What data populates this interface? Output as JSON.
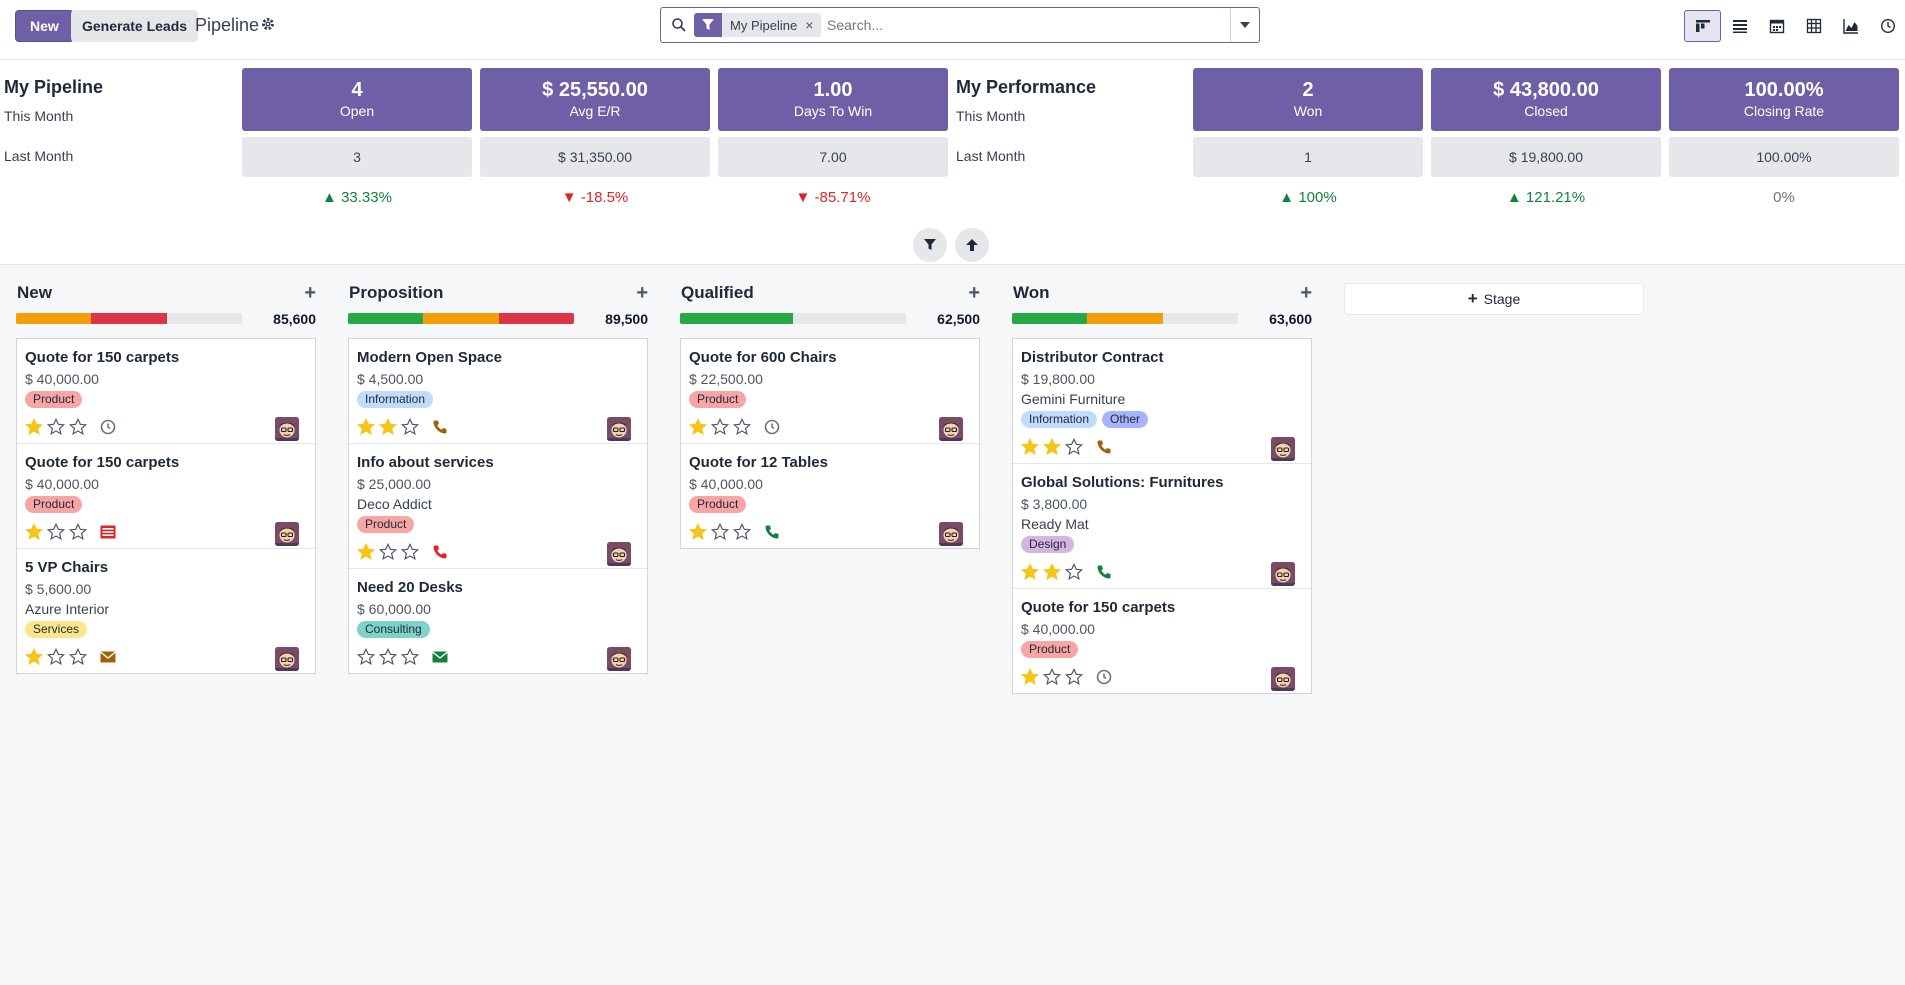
{
  "control": {
    "new_label": "New",
    "generate_label": "Generate Leads",
    "breadcrumb": "Pipeline",
    "search_facet": "My Pipeline",
    "search_placeholder": "Search...",
    "views": [
      "kanban-view-icon",
      "list-view-icon",
      "calendar-view-icon",
      "pivot-view-icon",
      "graph-view-icon",
      "activity-view-icon"
    ],
    "accent": "#6f5fa6"
  },
  "dashboard": {
    "pipeline": {
      "title": "My Pipeline",
      "this_month": "This Month",
      "last_month": "Last Month",
      "kpis": [
        {
          "value": "4",
          "label": "Open",
          "last": "3",
          "delta": "33.33%",
          "trend": "up"
        },
        {
          "value": "$ 25,550.00",
          "label": "Avg E/R",
          "last": "$ 31,350.00",
          "delta": "-18.5%",
          "trend": "down"
        },
        {
          "value": "1.00",
          "label": "Days To Win",
          "last": "7.00",
          "delta": "-85.71%",
          "trend": "down"
        }
      ]
    },
    "performance": {
      "title": "My Performance",
      "this_month": "This Month",
      "last_month": "Last Month",
      "kpis": [
        {
          "value": "2",
          "label": "Won",
          "last": "1",
          "delta": "100%",
          "trend": "up"
        },
        {
          "value": "$ 43,800.00",
          "label": "Closed",
          "last": "$ 19,800.00",
          "delta": "121.21%",
          "trend": "up"
        },
        {
          "value": "100.00%",
          "label": "Closing Rate",
          "last": "100.00%",
          "delta": "0%",
          "trend": "flat"
        }
      ]
    }
  },
  "kanban": {
    "add_stage_label": "Stage",
    "columns": [
      {
        "title": "New",
        "total": "85,600",
        "progress": [
          {
            "color": "#f59e0b",
            "pct": 33.3
          },
          {
            "color": "#dc3545",
            "pct": 33.3
          }
        ],
        "cards": [
          {
            "title": "Quote for 150 carpets",
            "amount": "$ 40,000.00",
            "company": "",
            "tags": [
              {
                "label": "Product",
                "color": "#f8a5a5"
              }
            ],
            "stars": 1,
            "activity": "clock",
            "activity_color": "#6b7280"
          },
          {
            "title": "Quote for 150 carpets",
            "amount": "$ 40,000.00",
            "company": "",
            "tags": [
              {
                "label": "Product",
                "color": "#f8a5a5"
              }
            ],
            "stars": 1,
            "activity": "list",
            "activity_color": "#dc2626"
          },
          {
            "title": "5 VP Chairs",
            "amount": "$ 5,600.00",
            "company": "Azure Interior",
            "tags": [
              {
                "label": "Services",
                "color": "#fde68a"
              }
            ],
            "stars": 1,
            "activity": "mail",
            "activity_color": "#a16207"
          }
        ]
      },
      {
        "title": "Proposition",
        "total": "89,500",
        "progress": [
          {
            "color": "#28a745",
            "pct": 33.3
          },
          {
            "color": "#f59e0b",
            "pct": 33.3
          },
          {
            "color": "#dc3545",
            "pct": 33.4
          }
        ],
        "cards": [
          {
            "title": "Modern Open Space",
            "amount": "$ 4,500.00",
            "company": "",
            "tags": [
              {
                "label": "Information",
                "color": "#bfdbfe"
              }
            ],
            "stars": 2,
            "activity": "phone",
            "activity_color": "#a16207"
          },
          {
            "title": "Info about services",
            "amount": "$ 25,000.00",
            "company": "Deco Addict",
            "tags": [
              {
                "label": "Product",
                "color": "#f8a5a5"
              }
            ],
            "stars": 1,
            "activity": "phone",
            "activity_color": "#dc2626"
          },
          {
            "title": "Need 20 Desks",
            "amount": "$ 60,000.00",
            "company": "",
            "tags": [
              {
                "label": "Consulting",
                "color": "#7dd3c8"
              }
            ],
            "stars": 0,
            "activity": "mail",
            "activity_color": "#15803d"
          }
        ]
      },
      {
        "title": "Qualified",
        "total": "62,500",
        "progress": [
          {
            "color": "#28a745",
            "pct": 50
          }
        ],
        "cards": [
          {
            "title": "Quote for 600 Chairs",
            "amount": "$ 22,500.00",
            "company": "",
            "tags": [
              {
                "label": "Product",
                "color": "#f8a5a5"
              }
            ],
            "stars": 1,
            "activity": "clock",
            "activity_color": "#6b7280"
          },
          {
            "title": "Quote for 12 Tables",
            "amount": "$ 40,000.00",
            "company": "",
            "tags": [
              {
                "label": "Product",
                "color": "#f8a5a5"
              }
            ],
            "stars": 1,
            "activity": "phone",
            "activity_color": "#15803d"
          }
        ]
      },
      {
        "title": "Won",
        "total": "63,600",
        "progress": [
          {
            "color": "#28a745",
            "pct": 33.3
          },
          {
            "color": "#f59e0b",
            "pct": 33.3
          }
        ],
        "cards": [
          {
            "title": "Distributor Contract",
            "amount": "$ 19,800.00",
            "company": "Gemini Furniture",
            "tags": [
              {
                "label": "Information",
                "color": "#bfdbfe"
              },
              {
                "label": "Other",
                "color": "#a5b4fc"
              }
            ],
            "stars": 2,
            "activity": "phone",
            "activity_color": "#a16207"
          },
          {
            "title": "Global Solutions: Furnitures",
            "amount": "$ 3,800.00",
            "company": "Ready Mat",
            "tags": [
              {
                "label": "Design",
                "color": "#d8b4e2"
              }
            ],
            "stars": 2,
            "activity": "phone",
            "activity_color": "#15803d"
          },
          {
            "title": "Quote for 150 carpets",
            "amount": "$ 40,000.00",
            "company": "",
            "tags": [
              {
                "label": "Product",
                "color": "#f8a5a5"
              }
            ],
            "stars": 1,
            "activity": "clock",
            "activity_color": "#6b7280"
          }
        ]
      }
    ]
  }
}
